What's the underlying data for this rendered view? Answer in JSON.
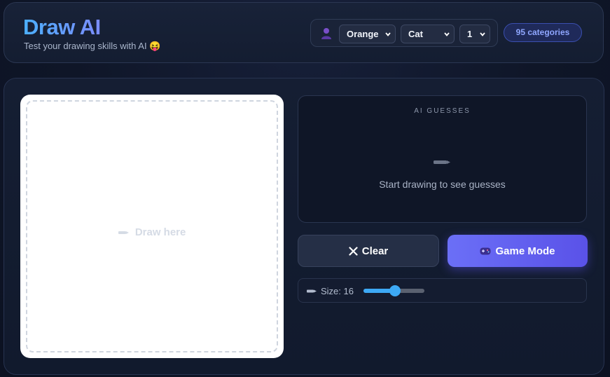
{
  "header": {
    "title": "Draw AI",
    "subtitle": "Test your drawing skills with AI 😝",
    "user_icon": "user-icon",
    "selects": {
      "color": "Orange",
      "category": "Cat",
      "count": "1"
    },
    "badge": "95 categories"
  },
  "canvas": {
    "hint": "Draw here",
    "hint_icon": "pencil-icon"
  },
  "guesses": {
    "title": "AI GUESSES",
    "empty_icon": "pencil-icon",
    "empty_text": "Start drawing to see guesses"
  },
  "buttons": {
    "clear_label": "Clear",
    "clear_icon": "x-icon",
    "game_label": "Game Mode",
    "game_icon": "gamepad-icon"
  },
  "brush": {
    "label_prefix": "Size: ",
    "label": "Size: 16",
    "value": 16,
    "min": 1,
    "max": 30
  },
  "colors": {
    "accent": "#5a52e8",
    "slider": "#3da9f5",
    "title_gradient_start": "#4cb0ff",
    "title_gradient_end": "#7b8cff"
  }
}
